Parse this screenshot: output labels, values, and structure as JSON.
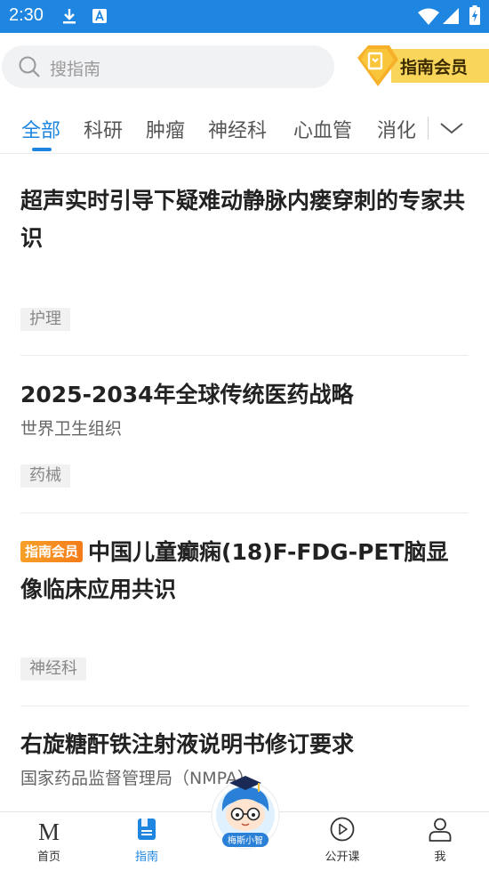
{
  "status_bar": {
    "time": "2:30",
    "icons": [
      "download-icon",
      "a-notification-icon",
      "wifi-icon",
      "signal-icon",
      "battery-icon"
    ]
  },
  "search": {
    "placeholder": "搜指南"
  },
  "member_badge": {
    "label": "指南会员"
  },
  "tabs": [
    {
      "label": "全部",
      "active": true
    },
    {
      "label": "科研",
      "active": false
    },
    {
      "label": "肿瘤",
      "active": false
    },
    {
      "label": "神经科",
      "active": false
    },
    {
      "label": "心血管",
      "active": false
    },
    {
      "label": "消化",
      "active": false
    }
  ],
  "articles": [
    {
      "title": "超声实时引导下疑难动静脉内瘘穿刺的专家共识",
      "subtitle": "",
      "tag": "护理",
      "member_only": false
    },
    {
      "title": "2025-2034年全球传统医药战略",
      "subtitle": "世界卫生组织",
      "tag": "药械",
      "member_only": false
    },
    {
      "title": "中国儿童癫痫(18)F-FDG-PET脑显像临床应用共识",
      "subtitle": "",
      "tag": "神经科",
      "member_only": true,
      "member_tag": "指南会员"
    },
    {
      "title": "右旋糖酐铁注射液说明书修订要求",
      "subtitle": "国家药品监督管理局（NMPA）",
      "tag": "",
      "member_only": false
    }
  ],
  "bottom_nav": [
    {
      "label": "首页",
      "icon": "m-logo-icon",
      "active": false
    },
    {
      "label": "指南",
      "icon": "book-icon",
      "active": true
    },
    {
      "label": "梅斯小智",
      "icon": "mascot-icon",
      "active": false
    },
    {
      "label": "公开课",
      "icon": "play-circle-icon",
      "active": false
    },
    {
      "label": "我",
      "icon": "person-icon",
      "active": false
    }
  ],
  "colors": {
    "primary": "#1e86e0",
    "member_orange": "#f47c1a",
    "member_gold": "#f9c53a"
  }
}
